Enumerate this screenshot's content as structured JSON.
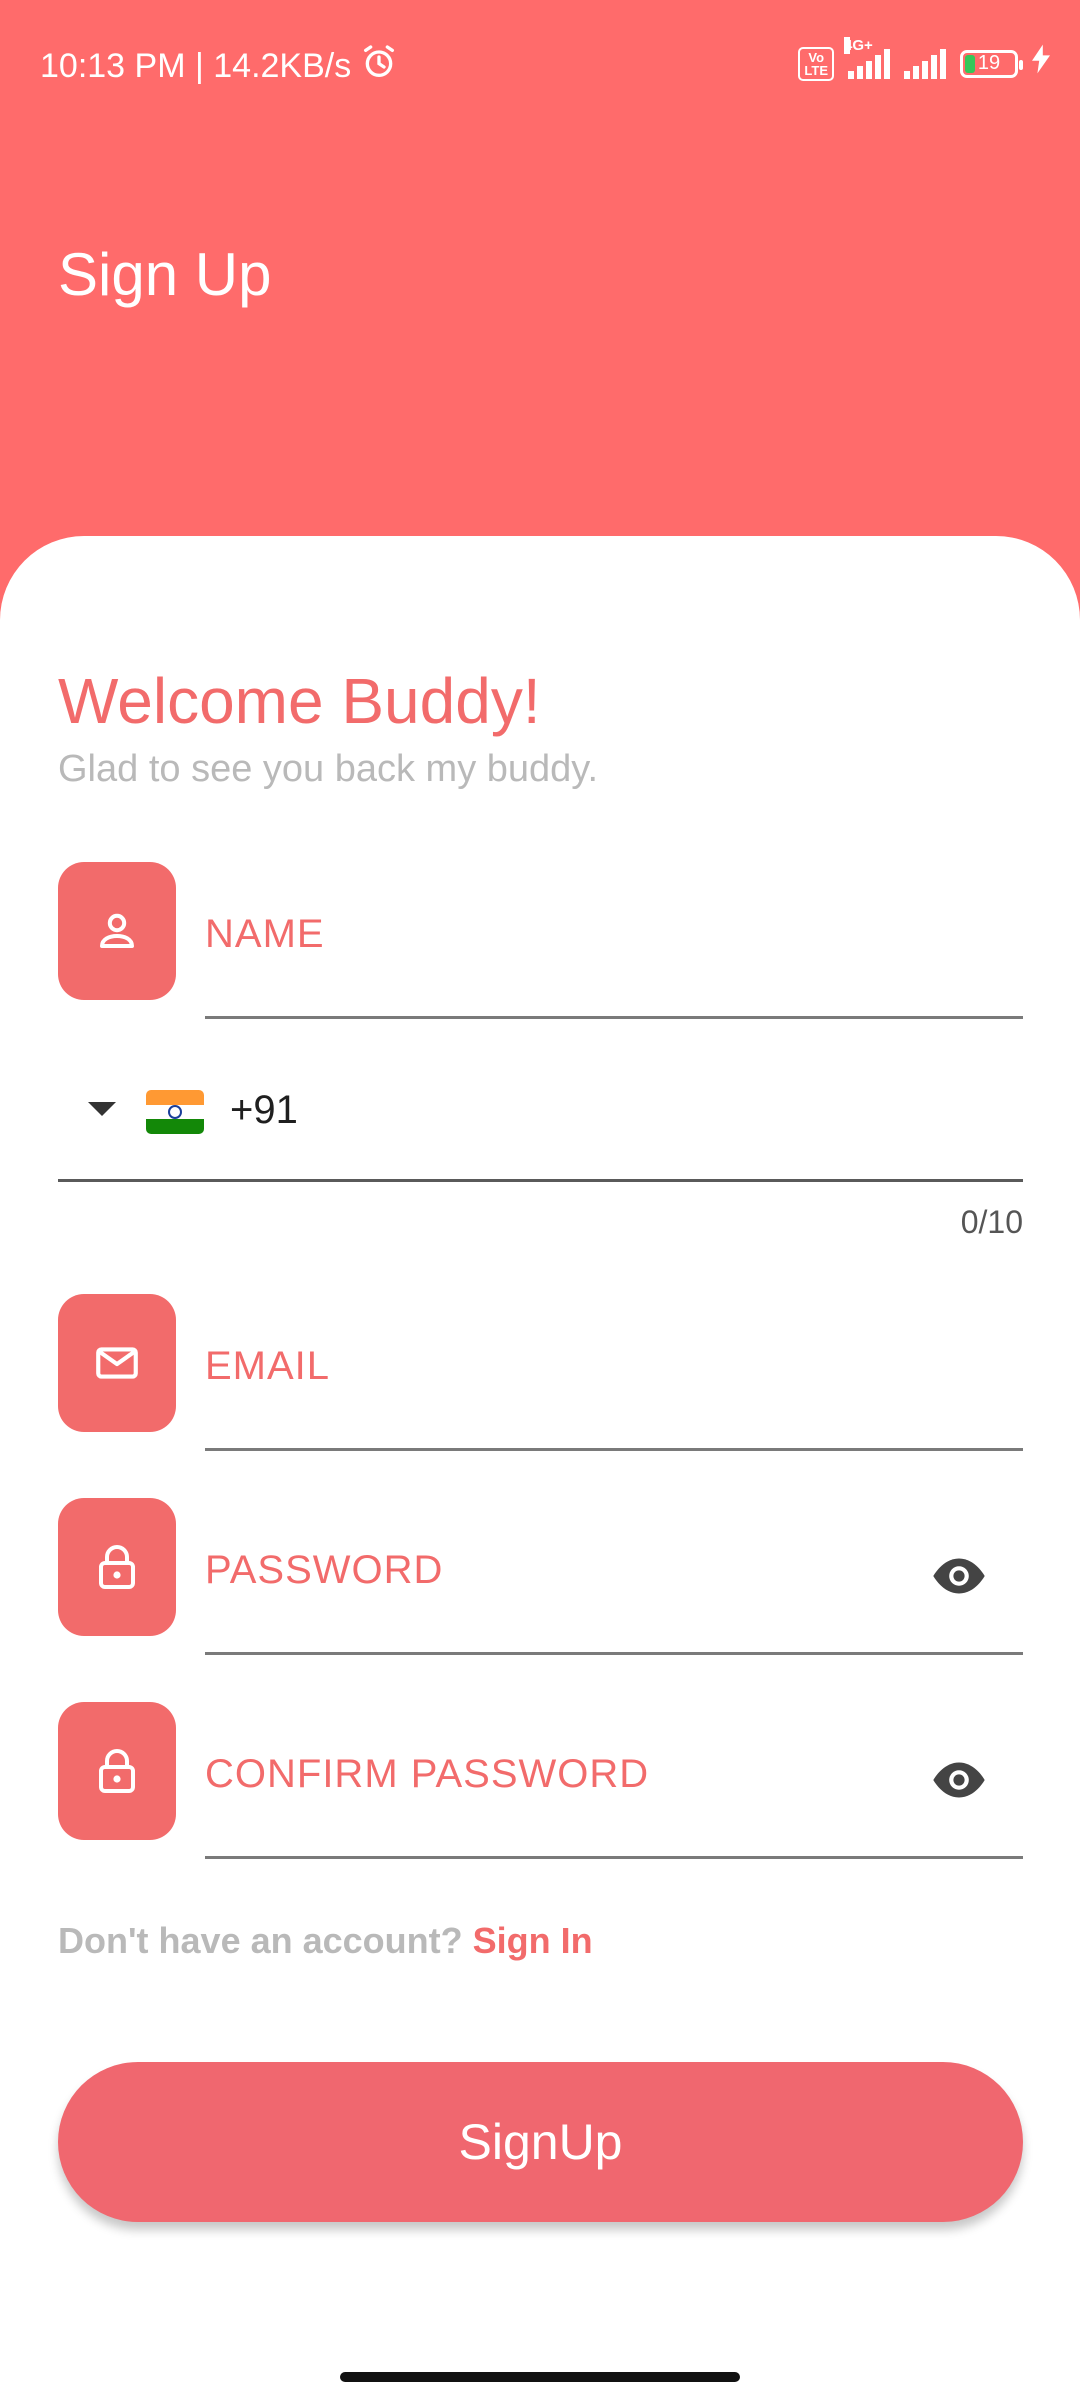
{
  "status_bar": {
    "time_speed": "10:13 PM | 14.2KB/s",
    "volte": "Vo\nLTE",
    "network": "4G+",
    "battery": "19"
  },
  "header": {
    "title": "Sign Up"
  },
  "form": {
    "welcome": "Welcome Buddy!",
    "subtitle": "Glad to see you back my buddy.",
    "name_label": "NAME",
    "dial_code": "+91",
    "phone_counter": "0/10",
    "email_label": "EMAIL",
    "password_label": "PASSWORD",
    "confirm_password_label": "CONFIRM PASSWORD"
  },
  "account": {
    "question": "Don't have an account?",
    "link": "Sign In"
  },
  "signup_button": "SignUp",
  "colors": {
    "header_bg": "#ff6b6b",
    "accent": "#f26b6b",
    "button": "#f0676f"
  },
  "icons": [
    "alarm-icon",
    "person-icon",
    "india-flag-icon",
    "dropdown-arrow-icon",
    "mail-icon",
    "lock-icon",
    "eye-icon"
  ]
}
